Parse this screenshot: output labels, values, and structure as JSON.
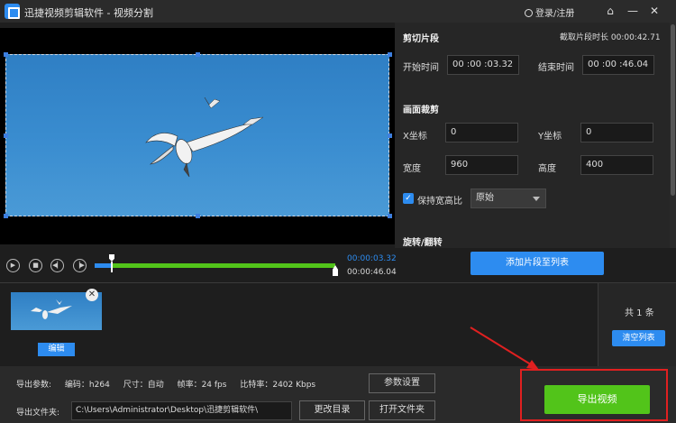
{
  "app": {
    "title": "迅捷视频剪辑软件 - 视频分割",
    "login_label": "登录/注册"
  },
  "panel": {
    "cut_section_title": "剪切片段",
    "clip_duration_label": "截取片段时长 00:00:42.71",
    "start_label": "开始时间",
    "start_value": "00 :00 :03.32",
    "end_label": "结束时间",
    "end_value": "00 :00 :46.04",
    "crop_section_title": "画面裁剪",
    "x_label": "X坐标",
    "x_value": "0",
    "y_label": "Y坐标",
    "y_value": "0",
    "width_label": "宽度",
    "width_value": "960",
    "height_label": "高度",
    "height_value": "400",
    "keep_ratio_label": "保持宽高比",
    "ratio_selected": "原始",
    "rotate_section_title": "旋转/翻转",
    "add_clip_button": "添加片段至列表"
  },
  "timeline": {
    "current_time": "00:00:03.32",
    "end_time": "00:00:46.04"
  },
  "cliplist": {
    "edit_button": "编辑",
    "count_label": "共 1 条",
    "clear_button": "清空列表"
  },
  "bottom": {
    "params_label": "导出参数:",
    "codec": "编码：h264",
    "size": "尺寸：自动",
    "fps": "帧率：24 fps",
    "bitrate": "比特率：2402 Kbps",
    "settings_button": "参数设置",
    "folder_label": "导出文件夹:",
    "folder_path": "C:\\Users\\Administrator\\Desktop\\迅捷剪辑软件\\",
    "change_dir_button": "更改目录",
    "open_folder_button": "打开文件夹",
    "export_button": "导出视频"
  },
  "colors": {
    "accent_blue": "#2d8cf0",
    "accent_green": "#52c41a",
    "highlight_red": "#e02020"
  },
  "icons": [
    "app-logo-icon",
    "user-icon",
    "home-icon",
    "minimize-icon",
    "close-icon",
    "play-icon",
    "stop-icon",
    "prev-frame-icon",
    "next-frame-icon",
    "check-icon",
    "chevron-down-icon",
    "remove-clip-icon"
  ]
}
